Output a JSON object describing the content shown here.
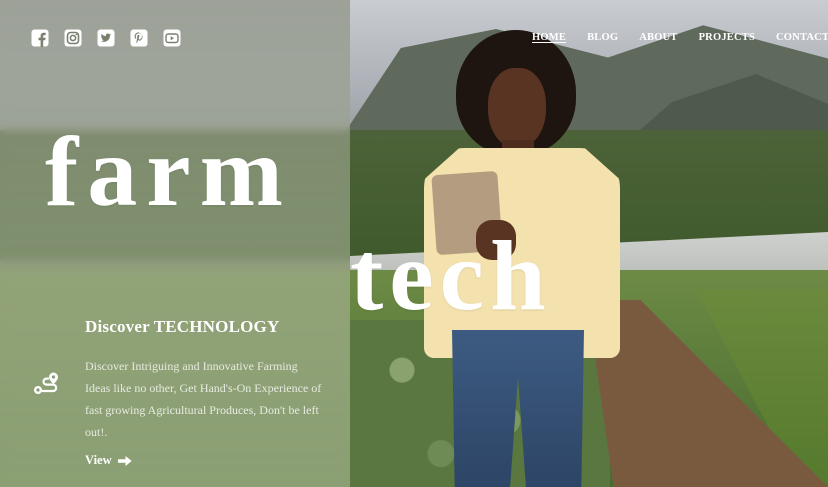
{
  "social": {
    "items": [
      {
        "icon": "facebook-icon"
      },
      {
        "icon": "instagram-icon"
      },
      {
        "icon": "twitter-icon"
      },
      {
        "icon": "pinterest-icon"
      },
      {
        "icon": "youtube-icon"
      }
    ]
  },
  "nav": {
    "items": [
      {
        "label": "HOME",
        "active": true
      },
      {
        "label": "BLOG"
      },
      {
        "label": "ABOUT"
      },
      {
        "label": "PROJECTS"
      },
      {
        "label": "CONTACTS"
      }
    ]
  },
  "hero": {
    "title_line1": "farm",
    "title_line2": "tech"
  },
  "feature": {
    "icon": "route-icon",
    "heading": "Discover TECHNOLOGY",
    "description": "Discover Intriguing and Innovative Farming Ideas like no other, Get Hand's-On Experience of fast growing Agricultural Produces, Don't be left out!.",
    "cta_label": "View",
    "cta_icon": "arrow-right-icon"
  },
  "colors": {
    "text": "#ffffff",
    "panel_overlay": "rgba(205,214,196,0.38)"
  }
}
